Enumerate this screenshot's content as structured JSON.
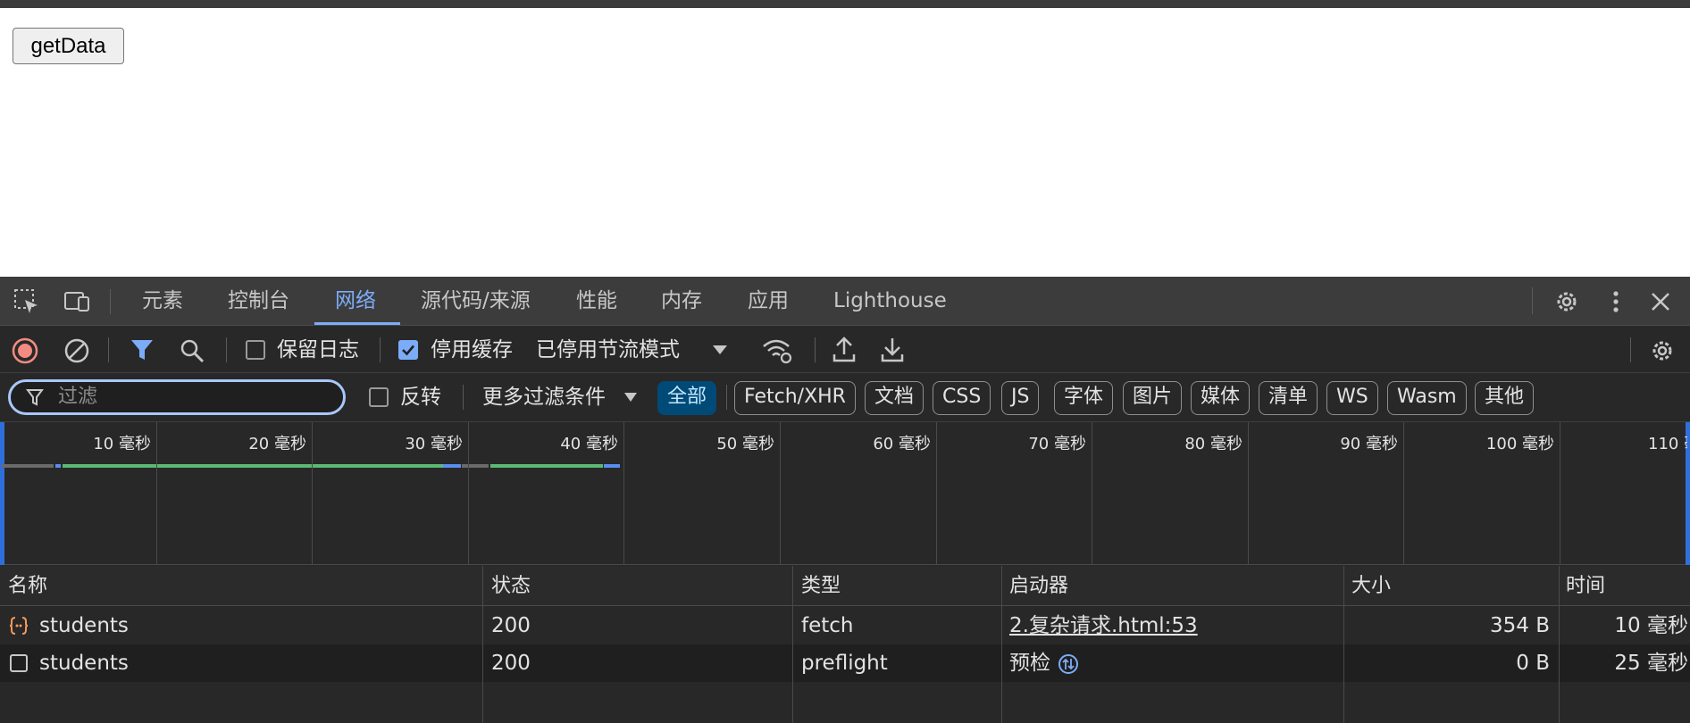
{
  "page": {
    "button_label": "getData"
  },
  "devtools": {
    "tabs": [
      {
        "label": "元素"
      },
      {
        "label": "控制台"
      },
      {
        "label": "网络"
      },
      {
        "label": "源代码/来源"
      },
      {
        "label": "性能"
      },
      {
        "label": "内存"
      },
      {
        "label": "应用"
      },
      {
        "label": "Lighthouse"
      }
    ],
    "active_tab": "网络",
    "toolbar": {
      "preserve_log_label": "保留日志",
      "preserve_log_checked": false,
      "disable_cache_label": "停用缓存",
      "disable_cache_checked": true,
      "throttling_label": "已停用节流模式"
    },
    "filter": {
      "placeholder": "过滤",
      "invert_label": "反转",
      "more_filters_label": "更多过滤条件",
      "chips": [
        "全部",
        "Fetch/XHR",
        "文档",
        "CSS",
        "JS",
        "字体",
        "图片",
        "媒体",
        "清单",
        "WS",
        "Wasm",
        "其他"
      ],
      "active_chip": "全部"
    },
    "overview": {
      "ticks": [
        "10 毫秒",
        "20 毫秒",
        "30 毫秒",
        "40 毫秒",
        "50 毫秒",
        "60 毫秒",
        "70 毫秒",
        "80 毫秒",
        "90 毫秒",
        "100 毫秒",
        "110 毫"
      ]
    },
    "table": {
      "headers": [
        "名称",
        "状态",
        "类型",
        "启动器",
        "大小",
        "时间"
      ],
      "rows": [
        {
          "name": "students",
          "status": "200",
          "type": "fetch",
          "initiator": "2.复杂请求.html:53",
          "size": "354 B",
          "time": "10 毫秒",
          "icon": "fetch-braces-icon"
        },
        {
          "name": "students",
          "status": "200",
          "type": "preflight",
          "initiator": "预检",
          "size": "0 B",
          "time": "25 毫秒",
          "icon": "document-square-icon"
        }
      ]
    },
    "colors": {
      "accent": "#7cacf8",
      "record_red": "#f28b82",
      "fetch_orange": "#f29b5c",
      "timing_green": "#5bb974",
      "timing_blue": "#5a8df0"
    }
  }
}
